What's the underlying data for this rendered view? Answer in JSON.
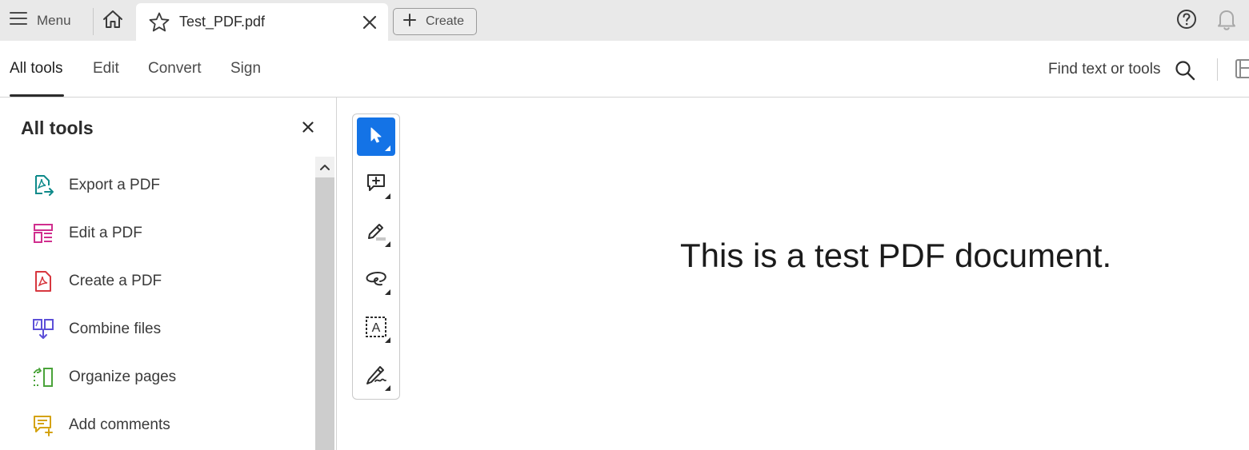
{
  "app": {
    "menu_label": "Menu",
    "tab_title": "Test_PDF.pdf",
    "create_label": "Create"
  },
  "toolbar": {
    "tabs": [
      {
        "label": "All tools",
        "active": true
      },
      {
        "label": "Edit",
        "active": false
      },
      {
        "label": "Convert",
        "active": false
      },
      {
        "label": "Sign",
        "active": false
      }
    ],
    "find_label": "Find text or tools"
  },
  "panel": {
    "title": "All tools",
    "tools": [
      {
        "label": "Export a PDF",
        "icon": "export-pdf-icon",
        "color": "#0e8a8a"
      },
      {
        "label": "Edit a PDF",
        "icon": "edit-pdf-icon",
        "color": "#d02e8e"
      },
      {
        "label": "Create a PDF",
        "icon": "create-pdf-icon",
        "color": "#d7373f"
      },
      {
        "label": "Combine files",
        "icon": "combine-files-icon",
        "color": "#5c4fd8"
      },
      {
        "label": "Organize pages",
        "icon": "organize-pages-icon",
        "color": "#4aa33a"
      },
      {
        "label": "Add comments",
        "icon": "add-comments-icon",
        "color": "#d4a20e"
      }
    ]
  },
  "quick_tools": [
    {
      "icon": "select-cursor-icon",
      "selected": true
    },
    {
      "icon": "add-comment-icon",
      "selected": false
    },
    {
      "icon": "highlight-icon",
      "selected": false
    },
    {
      "icon": "draw-lasso-icon",
      "selected": false
    },
    {
      "icon": "text-select-icon",
      "selected": false
    },
    {
      "icon": "sign-pen-icon",
      "selected": false
    }
  ],
  "document": {
    "text": "This is a test PDF document."
  },
  "colors": {
    "accent": "#1473e6",
    "tabbar_bg": "#e9e9e9"
  }
}
